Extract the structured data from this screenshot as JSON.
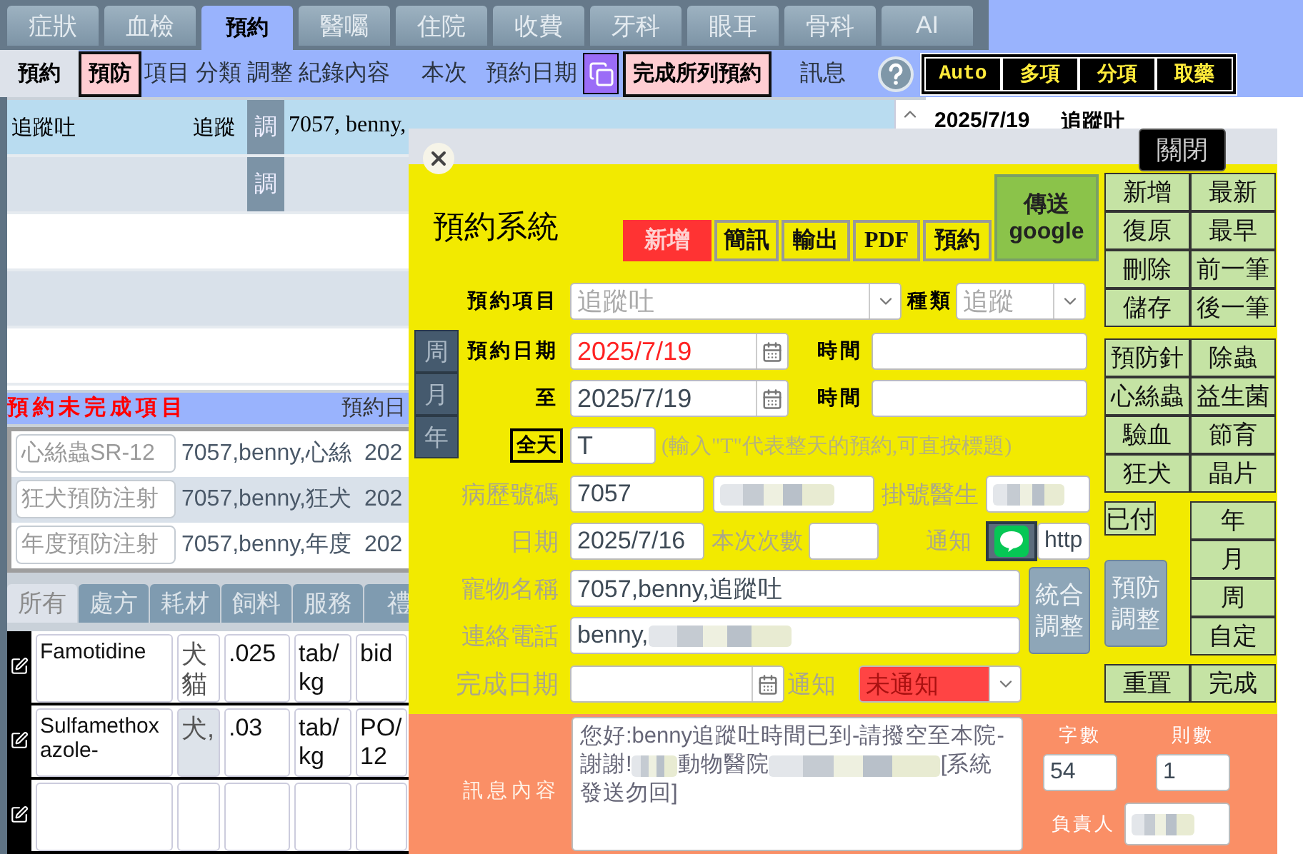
{
  "main_tabs": [
    {
      "label": "症狀",
      "selected": false
    },
    {
      "label": "血檢",
      "selected": false
    },
    {
      "label": "預約",
      "selected": true
    },
    {
      "label": "醫囑",
      "selected": false
    },
    {
      "label": "住院",
      "selected": false
    },
    {
      "label": "收費",
      "selected": false
    },
    {
      "label": "牙科",
      "selected": false
    },
    {
      "label": "眼耳",
      "selected": false
    },
    {
      "label": "骨科",
      "selected": false
    },
    {
      "label": "AI",
      "selected": false
    }
  ],
  "sub_header": {
    "tab": "預約",
    "filter_button": "預防",
    "columns": [
      "項目",
      "分類",
      "調整",
      "紀錄內容",
      "本次",
      "預約日期"
    ],
    "complete_button": "完成所列預約",
    "message_label": "訊息"
  },
  "mode_buttons": [
    "Auto",
    "多項",
    "分項",
    "取藥"
  ],
  "appointments": [
    {
      "item": "追蹤吐",
      "category": "追蹤",
      "adjust": "調",
      "record": "7057, benny,",
      "selected": true
    },
    {
      "adjust": "調",
      "selected": false
    },
    {
      "selected": false
    },
    {
      "selected": false
    },
    {
      "selected": false
    }
  ],
  "preview": {
    "date": "2025/7/19",
    "item": "追蹤吐"
  },
  "pending": {
    "title": "預約未完成項目",
    "column": "預約日",
    "rows": [
      {
        "item": "心絲蟲SR-12",
        "pet": "7057,benny,心絲",
        "date": "202"
      },
      {
        "item": "狂犬預防注射",
        "pet": "7057,benny,狂犬",
        "date": "202"
      },
      {
        "item": "年度預防注射",
        "pet": "7057,benny,年度",
        "date": "202"
      }
    ]
  },
  "product_tabs": [
    {
      "label": "所有",
      "selected": true
    },
    {
      "label": "處方",
      "selected": false
    },
    {
      "label": "耗材",
      "selected": false
    },
    {
      "label": "飼料",
      "selected": false
    },
    {
      "label": "服務",
      "selected": false
    },
    {
      "label": "禮",
      "selected": false
    }
  ],
  "products": [
    {
      "name": "Famotidine",
      "species": "犬貓",
      "dose": ".025",
      "unit": "tab/kg",
      "usage": "bid"
    },
    {
      "name": "Sulfamethoxazole-",
      "species": "犬,",
      "dose": ".03",
      "unit": "tab/kg",
      "usage": "PO/ 12"
    }
  ],
  "modal": {
    "title": "預約系統",
    "close_button": "關閉",
    "tabs": [
      {
        "label": "新增",
        "selected": true
      },
      {
        "label": "簡訊",
        "selected": false
      },
      {
        "label": "輸出",
        "selected": false
      },
      {
        "label": "PDF",
        "selected": false
      },
      {
        "label": "預約",
        "selected": false
      }
    ],
    "send_button": "傳送 google",
    "form": {
      "item_label": "預約項目",
      "item_value": "追蹤吐",
      "type_label": "種類",
      "type_value": "追蹤",
      "range_buttons": [
        "周",
        "月",
        "年"
      ],
      "date_label": "預約日期",
      "date": "2025/7/19",
      "time_label": "時間",
      "to_label": "至",
      "to_date": "2025/7/19",
      "to_time_label": "時間",
      "all_day_button": "全天",
      "all_day_value": "T",
      "all_day_hint": "(輸入\"T\"代表整天的預約,可直按標題)",
      "record_label": "病歷號碼",
      "record_no": "7057",
      "doctor_label": "掛號醫生",
      "visit_date_label": "日期",
      "visit_date": "2025/7/16",
      "count_label": "本次次數",
      "notify_label": "通知",
      "link_value": "http",
      "pet_label": "寵物名稱",
      "pet_value": "7057,benny,追蹤吐",
      "phone_label": "連絡電話",
      "phone_value": "benny,",
      "combined_adjust": "統合調整",
      "done_date_label": "完成日期",
      "notice_label": "通知",
      "notice_value": "未通知"
    },
    "side": {
      "records": [
        [
          "新增",
          "最新"
        ],
        [
          "復原",
          "最早"
        ],
        [
          "刪除",
          "前一筆"
        ],
        [
          "儲存",
          "後一筆"
        ]
      ],
      "categories": [
        [
          "預防針",
          "除蟲"
        ],
        [
          "心絲蟲",
          "益生菌"
        ],
        [
          "驗血",
          "節育"
        ],
        [
          "狂犬",
          "晶片"
        ]
      ],
      "paid": "已付",
      "preventive_adjust": "預防調整",
      "periods": [
        "年",
        "月",
        "周",
        "自定"
      ],
      "footer": [
        "重置",
        "完成"
      ]
    },
    "message": {
      "label": "訊息內容",
      "segments": [
        "您好:benny追蹤吐時間已到-請撥空至本院-謝謝!",
        "動物醫院",
        "[系統發送勿回]"
      ],
      "chars_label": "字數",
      "chars": "54",
      "parts_label": "則數",
      "parts": "1",
      "owner_label": "負責人"
    }
  }
}
